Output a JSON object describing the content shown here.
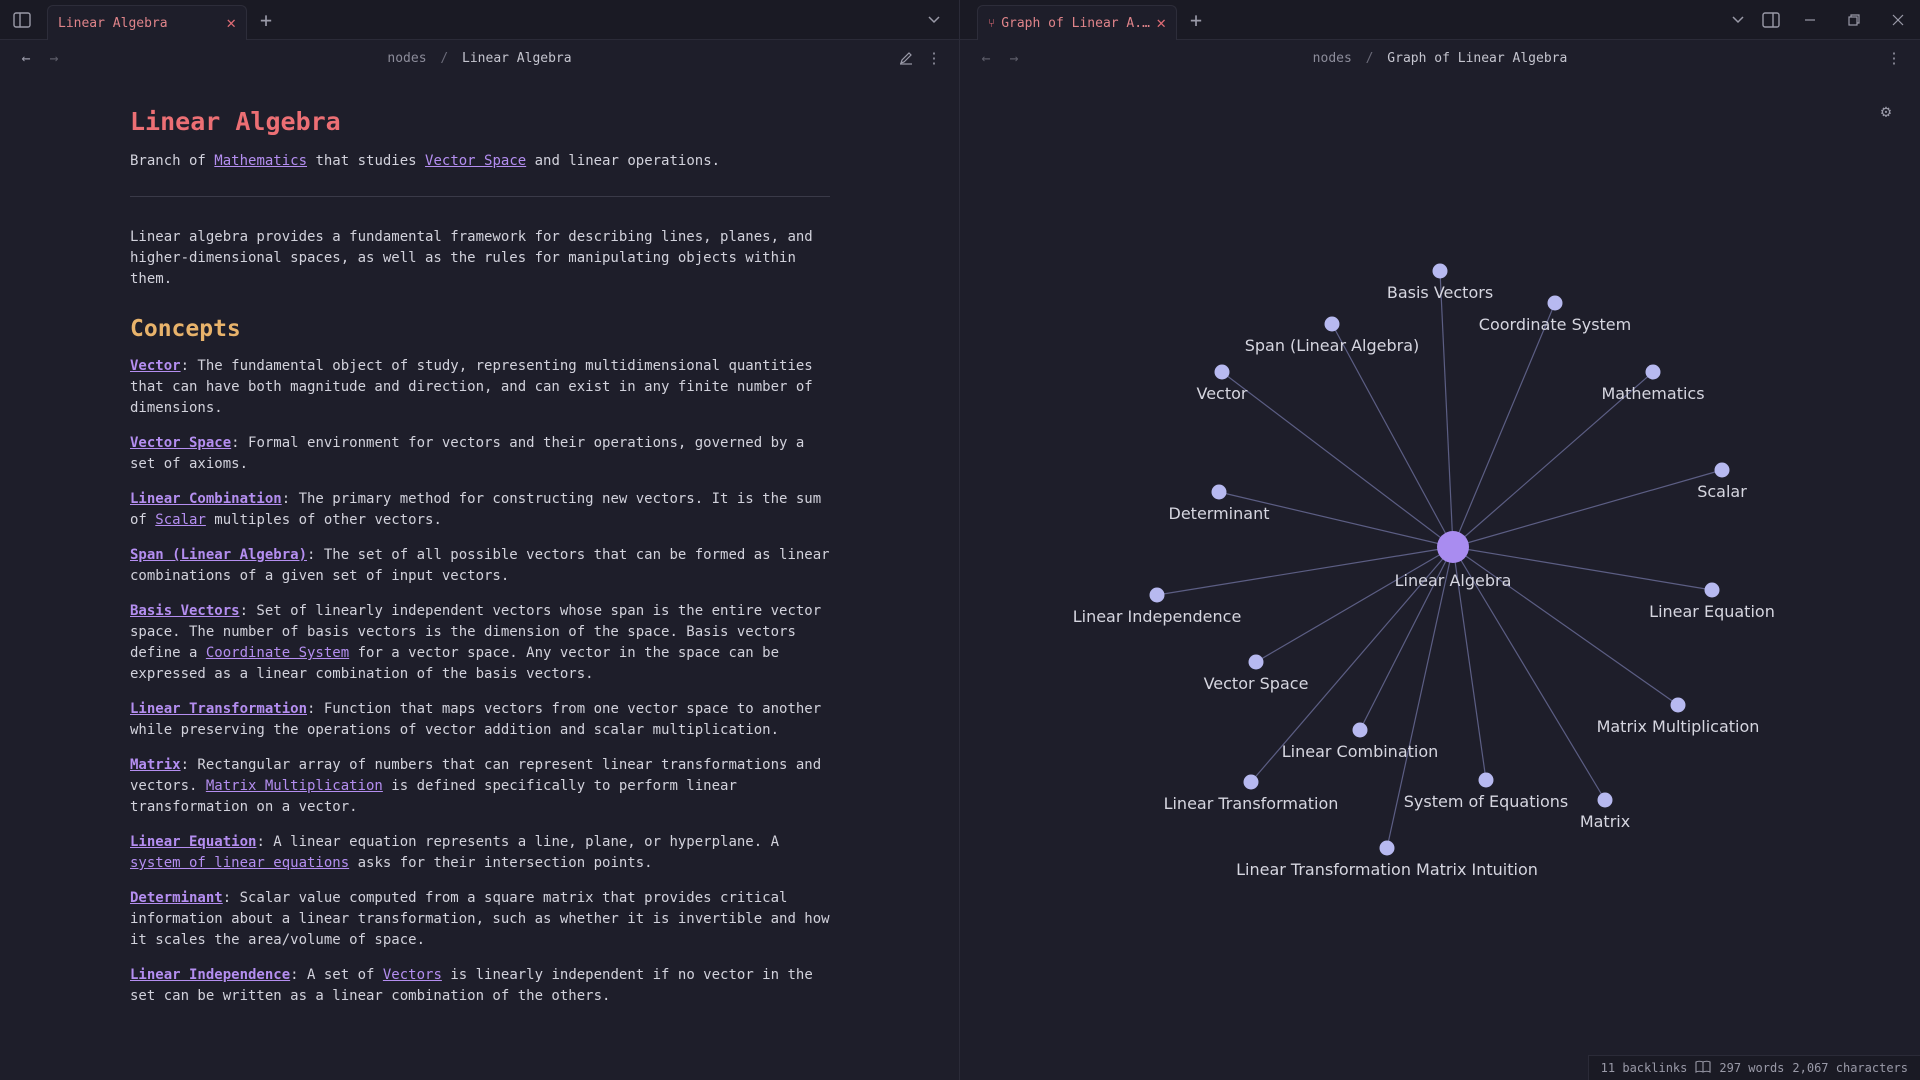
{
  "left_pane": {
    "tab_title": "Linear Algebra",
    "breadcrumb": {
      "folder": "nodes",
      "sep": "/",
      "current": "Linear Algebra"
    }
  },
  "right_pane": {
    "tab_title": "Graph of Linear A...",
    "breadcrumb": {
      "folder": "nodes",
      "sep": "/",
      "current": "Graph of Linear Algebra"
    }
  },
  "note": {
    "title": "Linear Algebra",
    "subtitle_parts": [
      "Branch of ",
      "Mathematics",
      " that studies ",
      "Vector Space",
      " and linear operations."
    ],
    "intro": "Linear algebra provides a fundamental framework for describing lines, planes, and higher-dimensional spaces, as well as the rules for manipulating objects within them.",
    "concepts_heading": "Concepts",
    "concepts": [
      {
        "term": "Vector",
        "parts": [
          ": The fundamental object of study, representing multidimensional quantities that can have both magnitude and direction, and can exist in any finite number of dimensions."
        ]
      },
      {
        "term": "Vector Space",
        "parts": [
          ": Formal environment for vectors and their operations, governed by a set of axioms."
        ]
      },
      {
        "term": "Linear Combination",
        "parts": [
          ": The primary method for constructing new vectors. It is the sum of ",
          {
            "link": "Scalar"
          },
          " multiples of other vectors."
        ]
      },
      {
        "term": "Span (Linear Algebra)",
        "parts": [
          ": The set of all possible vectors that can be formed as linear combinations of a given set of input vectors."
        ]
      },
      {
        "term": "Basis Vectors",
        "parts": [
          ": Set of linearly independent vectors whose span is the entire vector space. The number of basis vectors is the dimension of the space. Basis vectors define a ",
          {
            "link": "Coordinate System"
          },
          " for a vector space. Any vector in the space can be expressed as a linear combination of the basis vectors."
        ]
      },
      {
        "term": "Linear Transformation",
        "parts": [
          ": Function that maps vectors from one vector space to another while preserving the operations of vector addition and scalar multiplication."
        ]
      },
      {
        "term": "Matrix",
        "parts": [
          ": Rectangular array of numbers that can represent linear transformations and vectors. ",
          {
            "link": "Matrix Multiplication"
          },
          " is defined specifically to perform linear transformation on a vector."
        ]
      },
      {
        "term": "Linear Equation",
        "parts": [
          ": A linear equation represents a line, plane, or hyperplane. A ",
          {
            "link": "system of linear equations"
          },
          " asks for their intersection points."
        ]
      },
      {
        "term": "Determinant",
        "parts": [
          ": Scalar value computed from a square matrix that provides critical information about a linear transformation, such as whether it is invertible and how it scales the area/volume of space."
        ]
      },
      {
        "term": "Linear Independence",
        "parts": [
          ": A set of ",
          {
            "link": "Vectors"
          },
          " is linearly independent if no vector in the set can be written as a linear combination of the others."
        ]
      }
    ]
  },
  "graph": {
    "center": "Linear Algebra",
    "nodes": [
      "Basis Vectors",
      "Coordinate System",
      "Span (Linear Algebra)",
      "Mathematics",
      "Vector",
      "Scalar",
      "Determinant",
      "Linear Equation",
      "Linear Independence",
      "Vector Space",
      "Matrix Multiplication",
      "Linear Combination",
      "System of Equations",
      "Matrix",
      "Linear Transformation",
      "Linear Transformation Matrix Intuition"
    ],
    "colors": {
      "node": "#b7b9f0",
      "center": "#a98cf0",
      "edge": "#5c5e84"
    }
  },
  "status": {
    "backlinks": "11 backlinks",
    "words": "297 words",
    "characters": "2,067 characters"
  },
  "icons": {
    "sidebar_toggle": "sidebar-toggle-icon",
    "new_tab": "plus-icon",
    "tab_list": "chevron-down-icon",
    "back": "arrow-left-icon",
    "forward": "arrow-right-icon",
    "edit": "pencil-icon",
    "more": "more-vertical-icon",
    "graph_settings": "gear-icon",
    "right_sidebar": "right-sidebar-icon",
    "minimize": "minimize-icon",
    "restore": "restore-icon",
    "close": "close-icon",
    "graph_tab": "graph-icon",
    "reading": "book-icon"
  }
}
